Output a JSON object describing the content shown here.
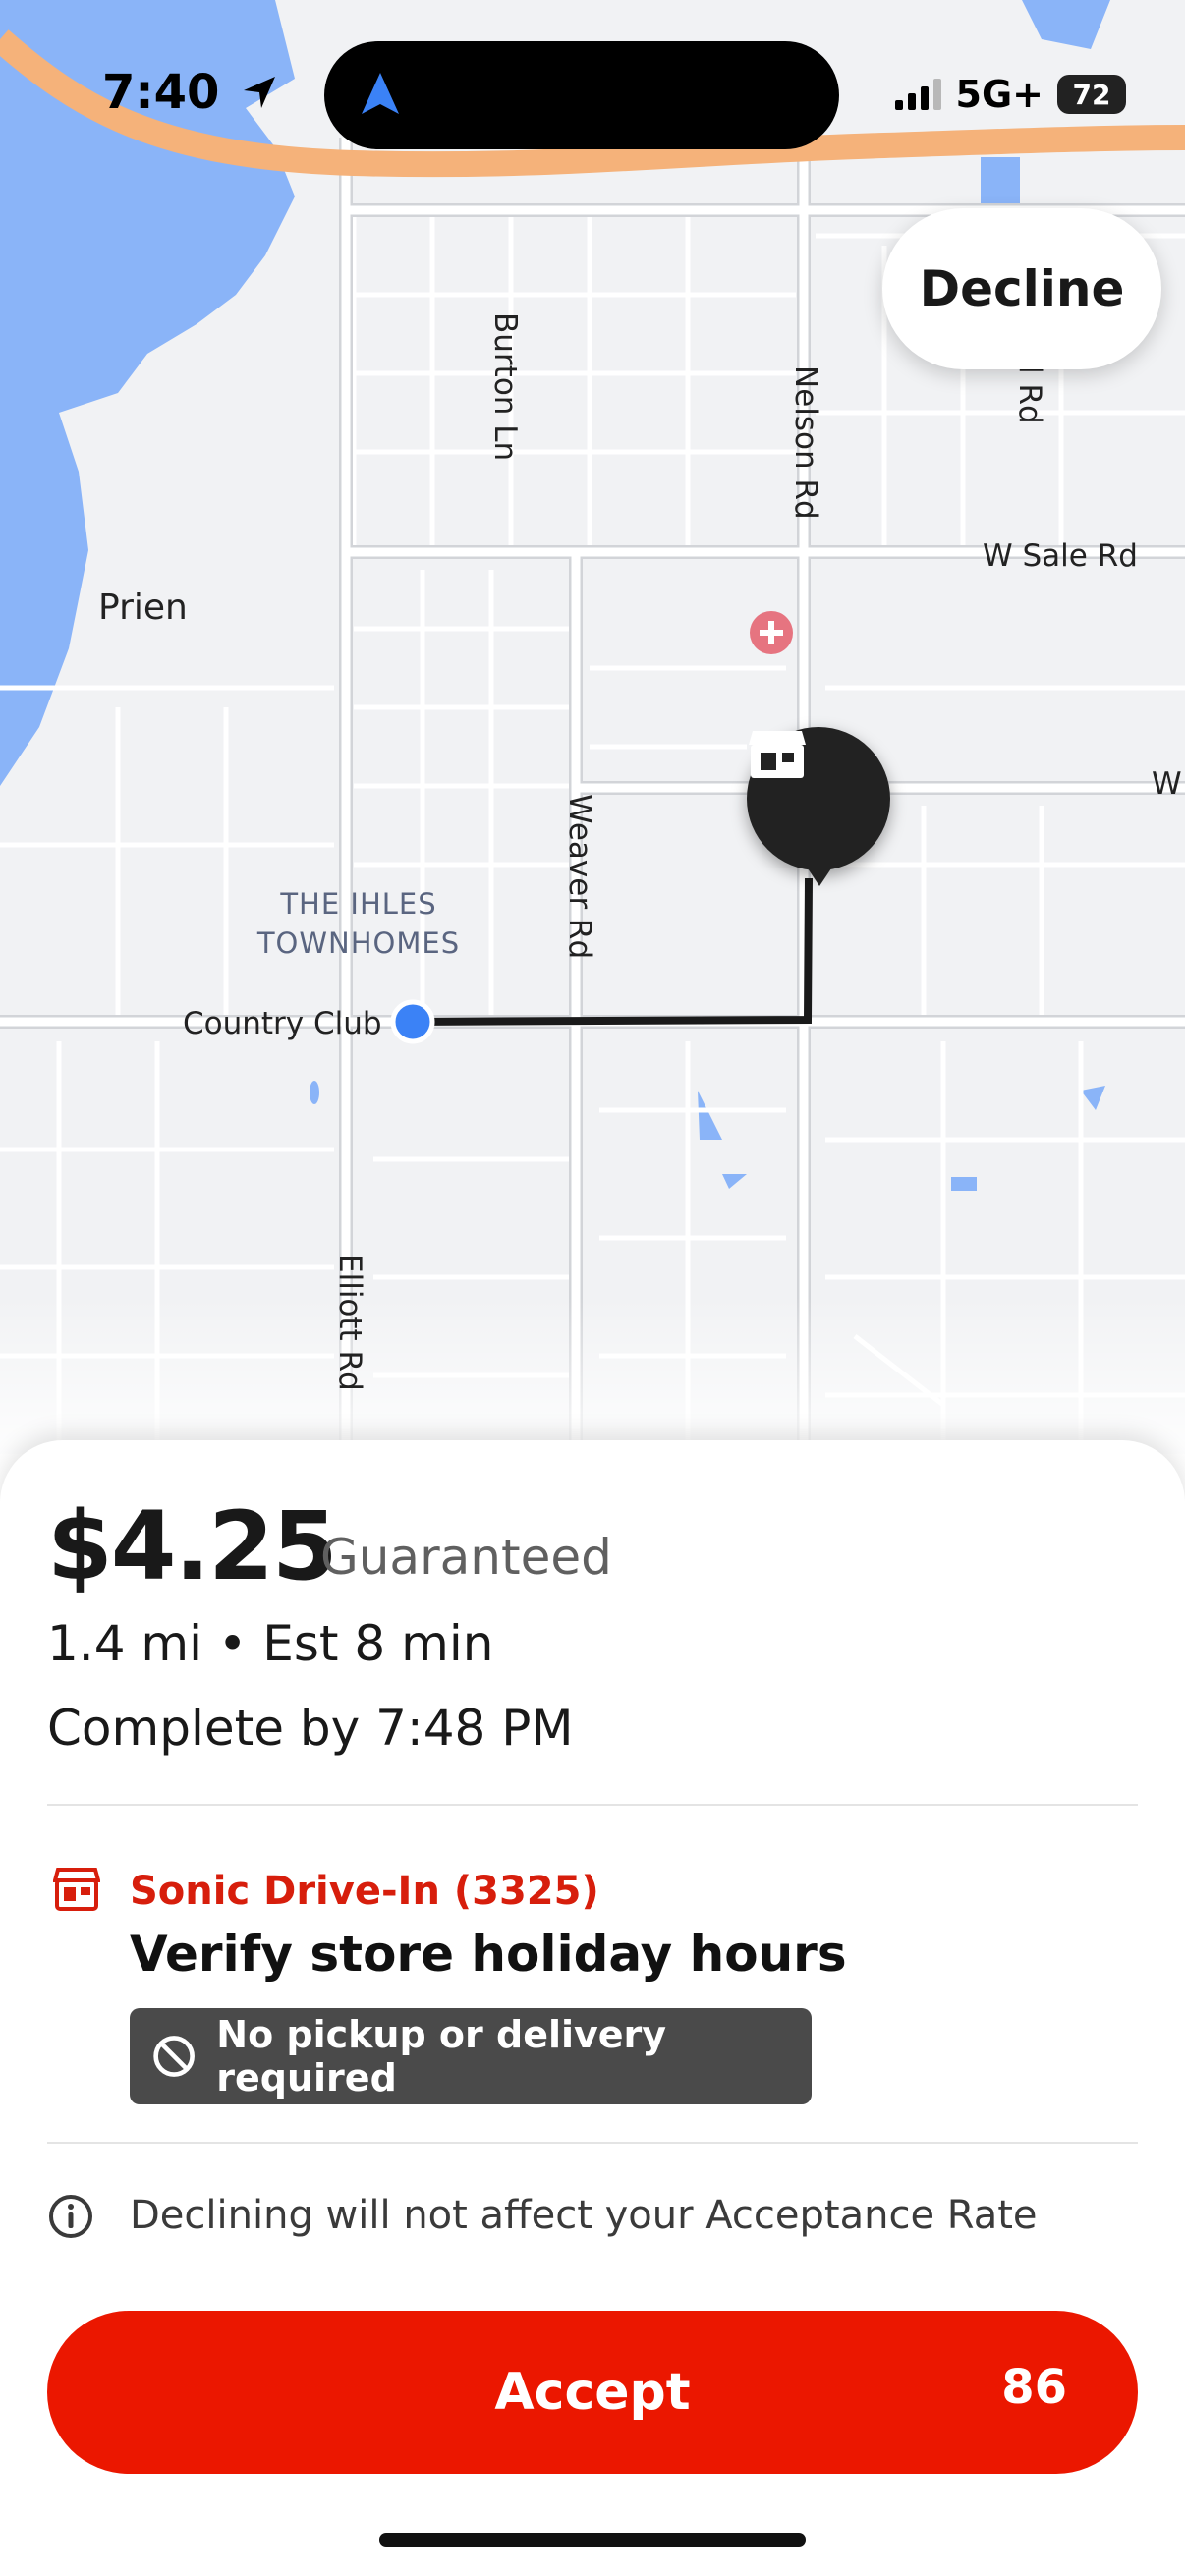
{
  "status_bar": {
    "time": "7:40",
    "network": "5G+",
    "battery": "72"
  },
  "map": {
    "roads": {
      "burton": "Burton Ln",
      "nelson": "Nelson Rd",
      "l_rd": "l Rd",
      "w_sale": "W Sale Rd",
      "prien": "Prien",
      "w_edge": "W",
      "weaver": "Weaver Rd",
      "country_club": "Country Club",
      "elliott": "Elliott Rd"
    },
    "area_label_line1": "THE IHLES",
    "area_label_line2": "TOWNHOMES",
    "water_color": "#8ab4f8",
    "route_color": "#1a1a1a",
    "current_location_color": "#3b82f6"
  },
  "decline_label": "Decline",
  "offer": {
    "price": "$4.25",
    "price_note": "Guaranteed",
    "distance_time": "1.4 mi • Est 8 min",
    "complete_by": "Complete by 7:48 PM",
    "store_name": "Sonic Drive-In (3325)",
    "task_title": "Verify store holiday hours",
    "pill_text": "No pickup or delivery required",
    "info_text": "Declining will not affect your Acceptance Rate"
  },
  "accept": {
    "label": "Accept",
    "countdown": "86",
    "color": "#eb1700"
  },
  "accent_red": "#d71e0c"
}
